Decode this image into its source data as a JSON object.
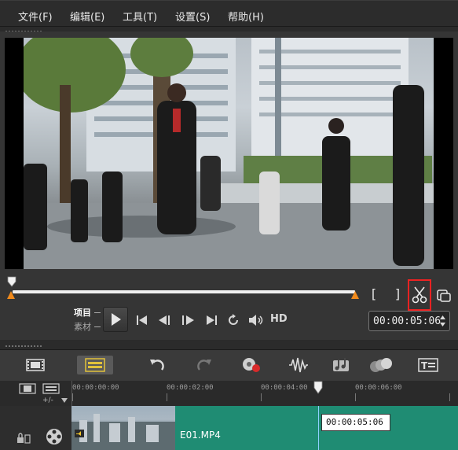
{
  "menu": {
    "file": "文件(F)",
    "edit": "编辑(E)",
    "tools": "工具(T)",
    "settings": "设置(S)",
    "help": "帮助(H)"
  },
  "player": {
    "project_label": "项目",
    "clip_label": "素材",
    "hd_label": "HD",
    "timecode": "00:00:05:06",
    "mark_in_symbol": "[",
    "mark_out_symbol": "]"
  },
  "ruler": {
    "labels": [
      "00:00:00:00",
      "00:00:02:00",
      "00:00:04:00",
      "00:00:06:00"
    ]
  },
  "timeline": {
    "clip_name": "E01.MP4",
    "tooltip_time": "00:00:05:06",
    "zoom_symbol": "+/-"
  }
}
